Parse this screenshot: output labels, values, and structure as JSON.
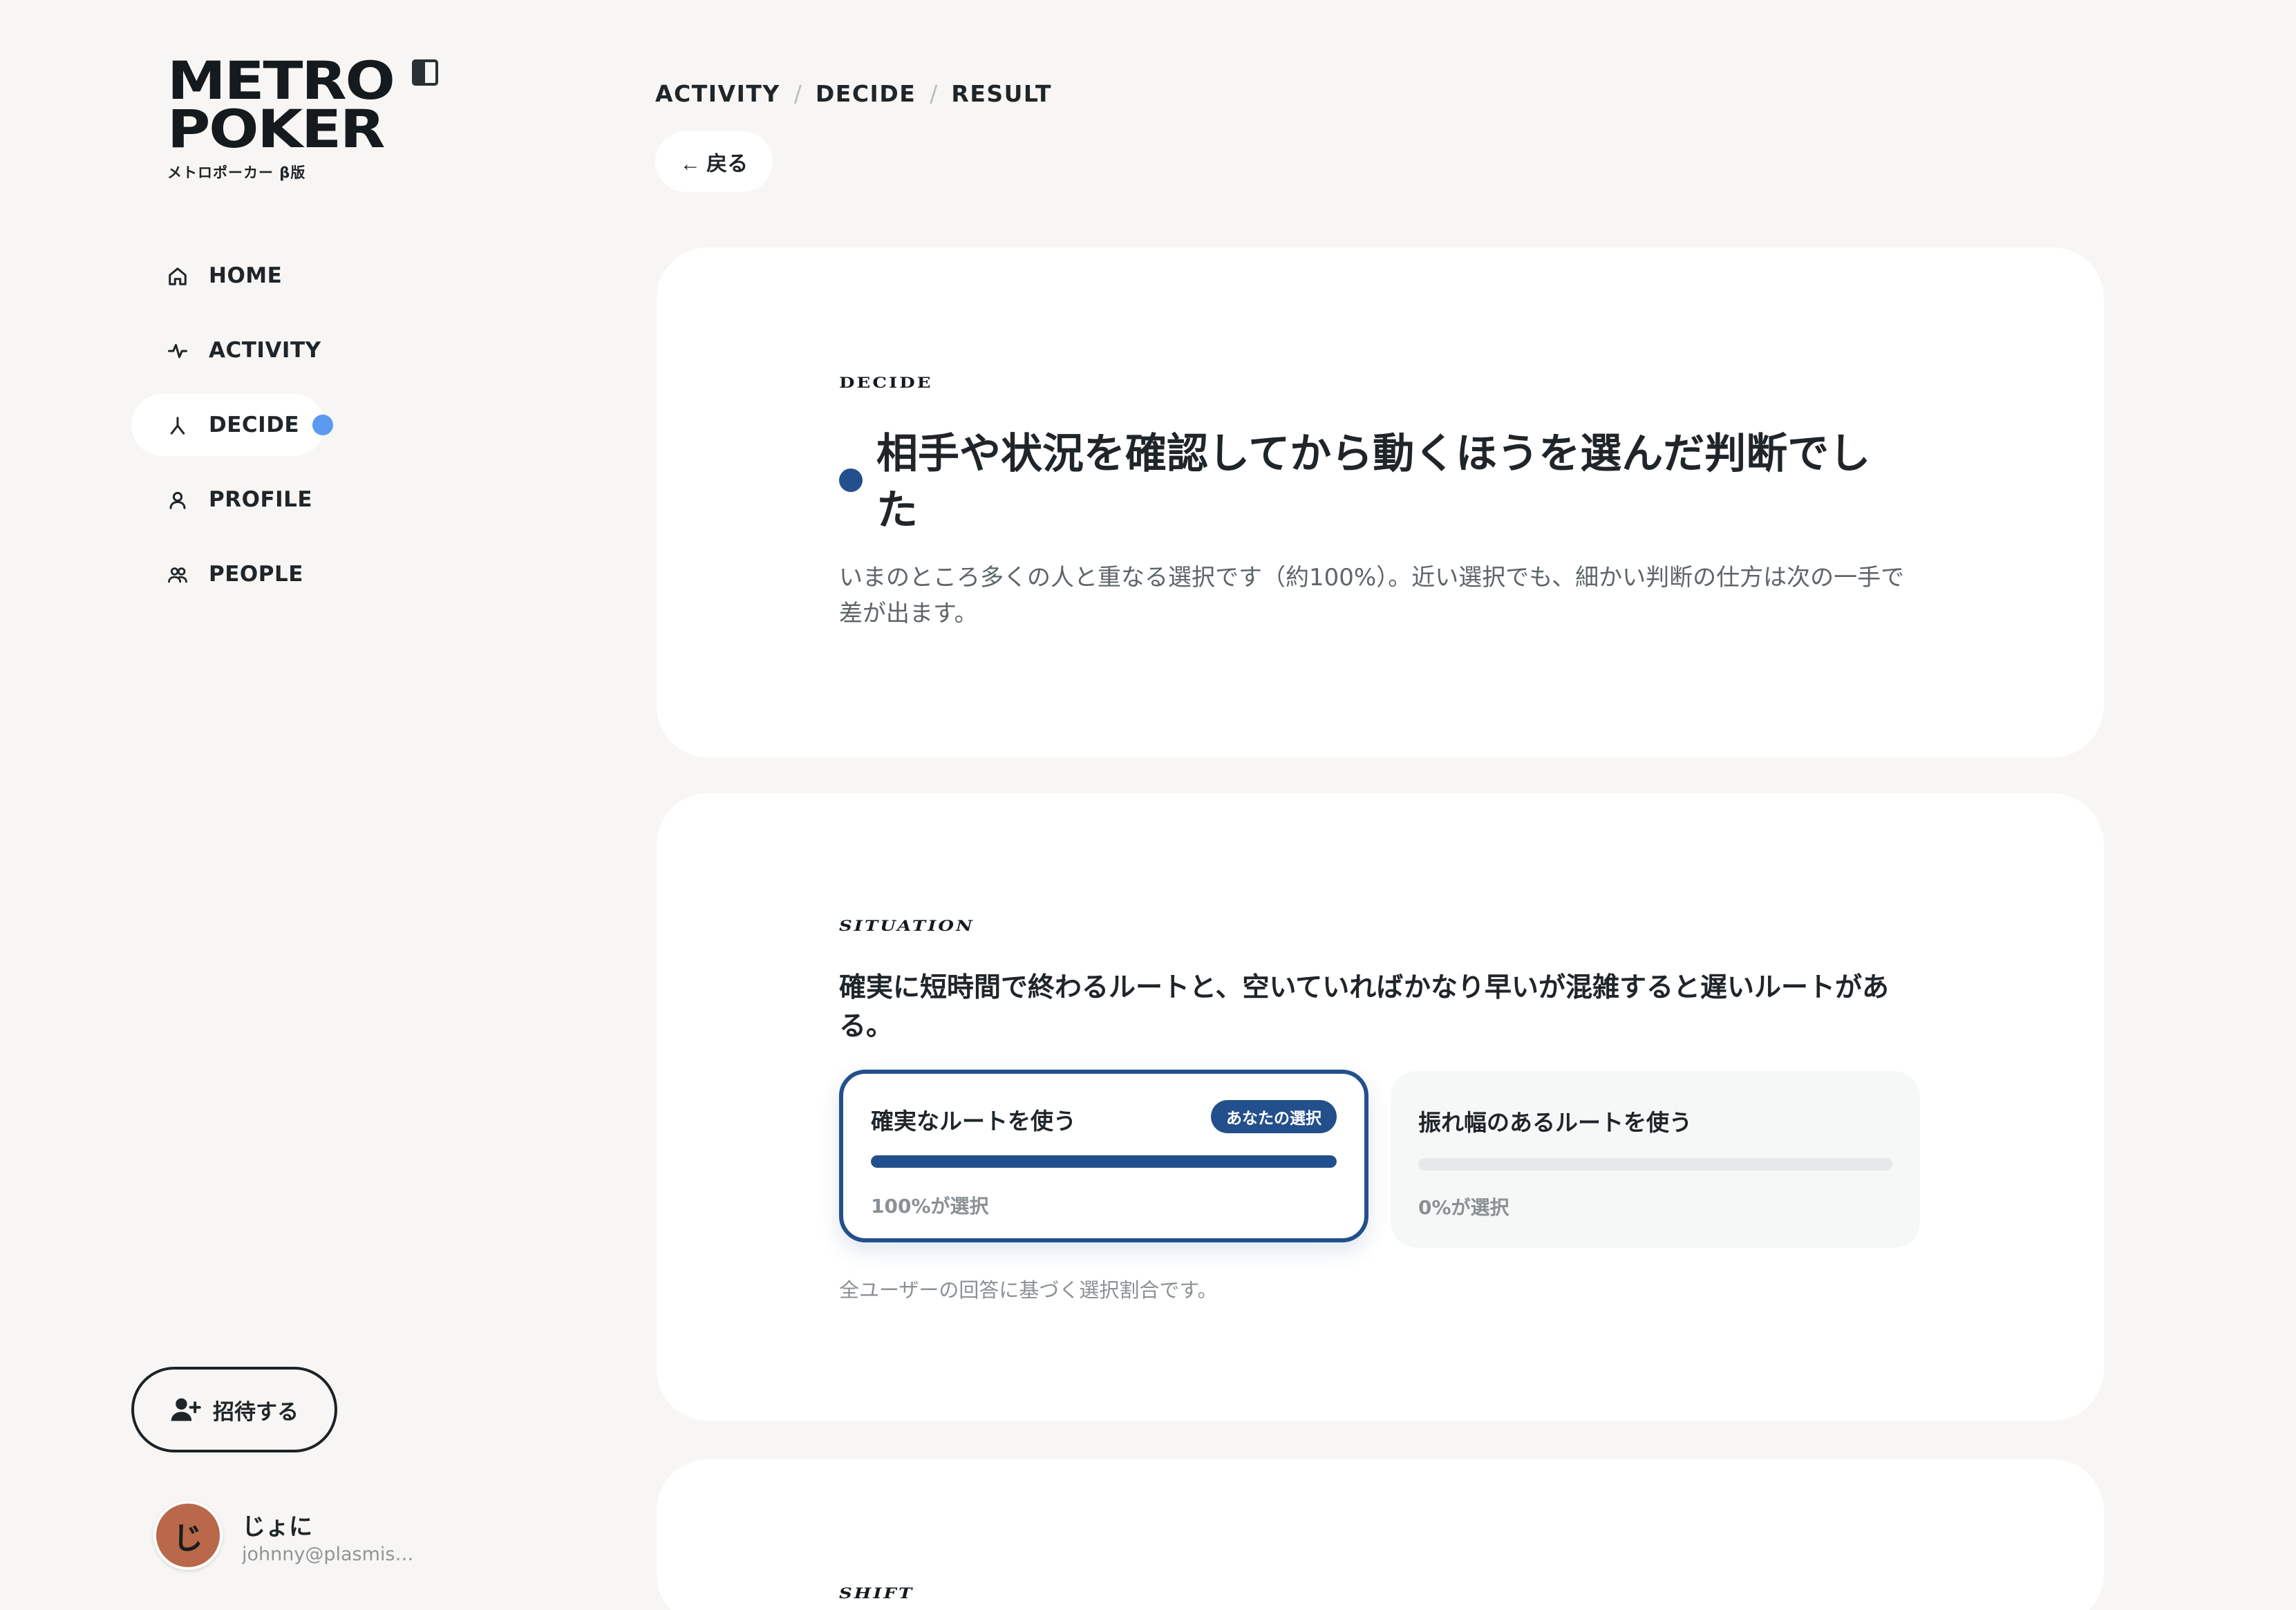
{
  "app": {
    "logo_line1": "METRO",
    "logo_line2": "POKER",
    "logo_sub": "メトロポーカー β版"
  },
  "sidebar": {
    "items": [
      {
        "label": "HOME",
        "icon": "home-icon",
        "active": false
      },
      {
        "label": "ACTIVITY",
        "icon": "activity-icon",
        "active": false
      },
      {
        "label": "DECIDE",
        "icon": "decide-icon",
        "active": true
      },
      {
        "label": "PROFILE",
        "icon": "profile-icon",
        "active": false
      },
      {
        "label": "PEOPLE",
        "icon": "people-icon",
        "active": false
      }
    ],
    "invite_label": "招待する",
    "user": {
      "initial": "じ",
      "name": "じょに",
      "email": "johnny@plasmis…"
    }
  },
  "breadcrumb": [
    "ACTIVITY",
    "DECIDE",
    "RESULT"
  ],
  "back_label": "← 戻る",
  "result": {
    "eyebrow": "DECIDE",
    "title": "相手や状況を確認してから動くほうを選んだ判断でした",
    "description": "いまのところ多くの人と重なる選択です（約100%）。近い選択でも、細かい判断の仕方は次の一手で差が出ます。"
  },
  "situation": {
    "eyebrow": "SITUATION",
    "text": "確実に短時間で終わるルートと、空いていればかなり早いが混雑すると遅いルートがある。",
    "options": [
      {
        "label": "確実なルートを使う",
        "pct_label": "100%が選択",
        "fraction": 1.0,
        "selected": true,
        "badge": "あなたの選択"
      },
      {
        "label": "振れ幅のあるルートを使う",
        "pct_label": "0%が選択",
        "fraction": 0.0,
        "selected": false
      }
    ],
    "footnote": "全ユーザーの回答に基づく選択割合です。"
  },
  "next_card": {
    "eyebrow": "SHIFT"
  },
  "colors": {
    "accent": "#23508c",
    "notification": "#5b9af0",
    "background": "#f7f6f4",
    "avatar": "#b9684a"
  }
}
